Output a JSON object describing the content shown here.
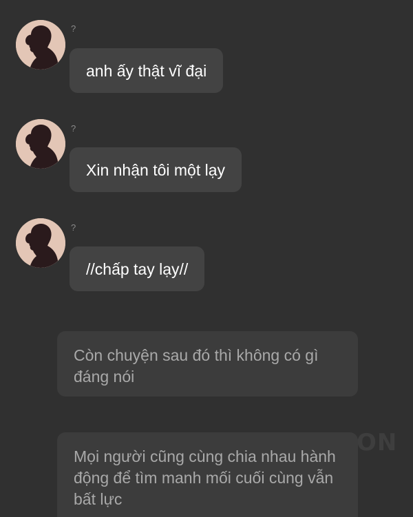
{
  "conversation": {
    "messages": [
      {
        "sender": "?",
        "text": "anh ấy thật vĩ đại"
      },
      {
        "sender": "?",
        "text": "Xin nhận tôi một lạy"
      },
      {
        "sender": "?",
        "text": "//chấp tay lạy//"
      }
    ],
    "narrations": [
      {
        "text": "Còn chuyện sau đó thì không có gì đáng nói"
      },
      {
        "text": "Mọi người cũng cùng chia nhau hành động để tìm manh mối cuối cùng vẫn bất lực"
      }
    ]
  },
  "watermark": {
    "text": "ON"
  },
  "colors": {
    "background": "#303030",
    "bubble": "#434343",
    "narration_bubble": "#3c3c3c",
    "avatar_bg": "#e3c6b6",
    "silhouette": "#2a1a1c"
  }
}
